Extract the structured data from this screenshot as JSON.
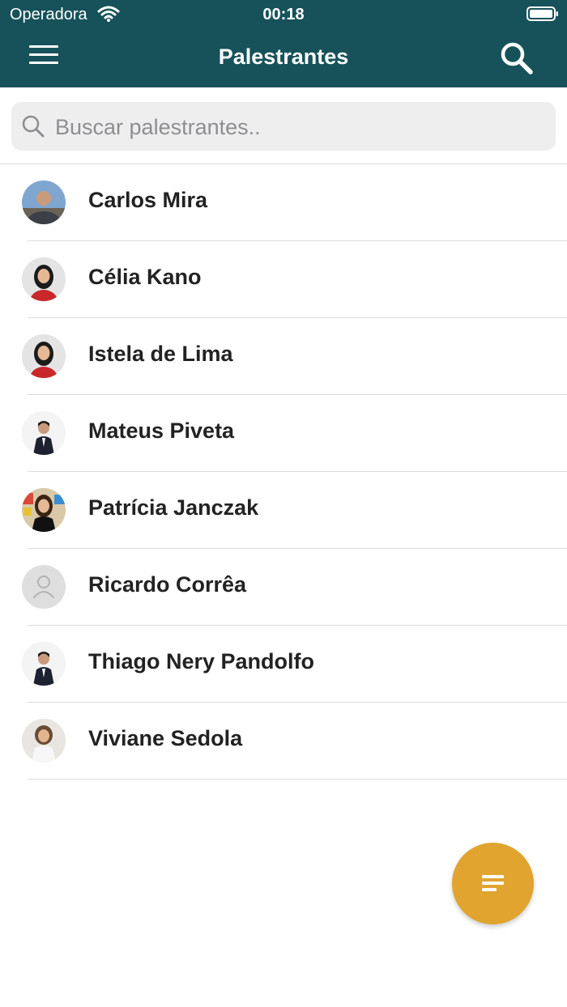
{
  "status_bar": {
    "carrier": "Operadora",
    "time": "00:18"
  },
  "header": {
    "title": "Palestrantes"
  },
  "search": {
    "placeholder": "Buscar palestrantes.."
  },
  "speakers": [
    {
      "name": "Carlos Mira",
      "avatar": "photo"
    },
    {
      "name": "Célia Kano",
      "avatar": "photo"
    },
    {
      "name": "Istela de Lima",
      "avatar": "photo"
    },
    {
      "name": "Mateus Piveta",
      "avatar": "photo"
    },
    {
      "name": "Patrícia Janczak",
      "avatar": "photo"
    },
    {
      "name": "Ricardo Corrêa",
      "avatar": "placeholder-person-icon"
    },
    {
      "name": "Thiago Nery Pandolfo",
      "avatar": "photo"
    },
    {
      "name": "Viviane Sedola",
      "avatar": "photo"
    }
  ],
  "colors": {
    "header": "#17525a",
    "fab": "#e0a42f"
  },
  "icons": {
    "menu": "hamburger-icon",
    "search": "search-icon",
    "fab": "filter-icon"
  }
}
